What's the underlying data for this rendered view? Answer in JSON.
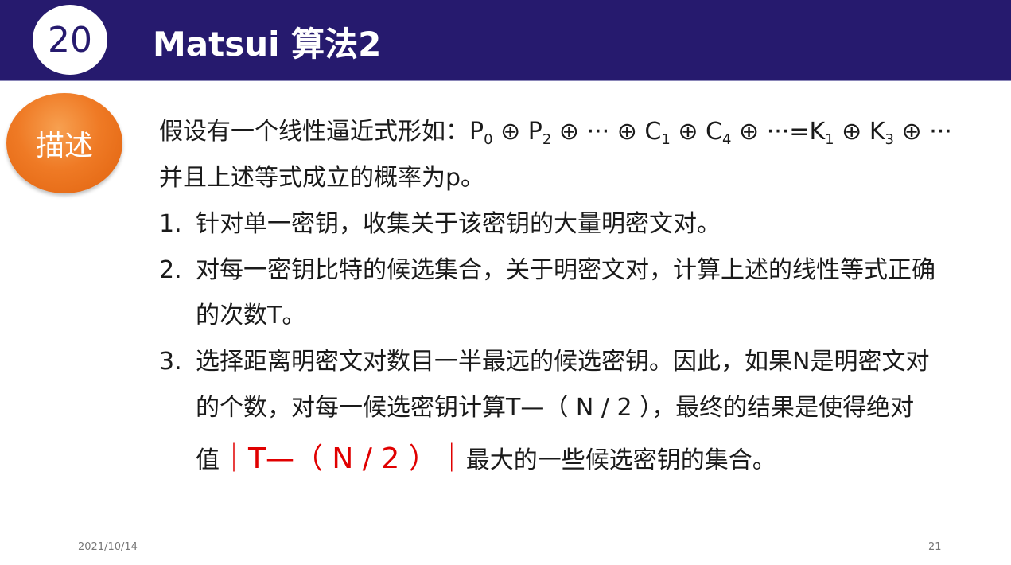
{
  "header": {
    "slide_number": "20",
    "title": "Matsui 算法2",
    "colors": {
      "bar": "#261a6e",
      "badge": "#ef7a25",
      "highlight": "#e00000"
    }
  },
  "badge": {
    "label": "描述"
  },
  "intro": {
    "formula_prefix": "假设有一个线性逼近式形如：",
    "p": "P",
    "p0_sub": "0",
    "p2_sub": "2",
    "xor": "⊕",
    "dots": "···",
    "c": "C",
    "c1_sub": "1",
    "c4_sub": "4",
    "equals": "=",
    "k": "K",
    "k1_sub": "1",
    "k3_sub": "3",
    "line2": "并且上述等式成立的概率为p。"
  },
  "steps": [
    {
      "num": "1.",
      "lines": [
        "针对单一密钥，收集关于该密钥的大量明密文对。"
      ]
    },
    {
      "num": "2.",
      "lines": [
        "对每一密钥比特的候选集合，关于明密文对，计算上述的线性等式正确",
        "的次数T。"
      ]
    },
    {
      "num": "3.",
      "lines": [
        "选择距离明密文对数目一半最远的候选密钥。因此，如果N是明密文对",
        "的个数，对每一候选密钥计算T—（ N / 2 ），最终的结果是使得绝对"
      ],
      "last_prefix": "值",
      "last_red": "｜T—（ N / 2 ）｜",
      "last_suffix": "最大的一些候选密钥的集合。"
    }
  ],
  "footer": {
    "date": "2021/10/14",
    "page": "21"
  }
}
